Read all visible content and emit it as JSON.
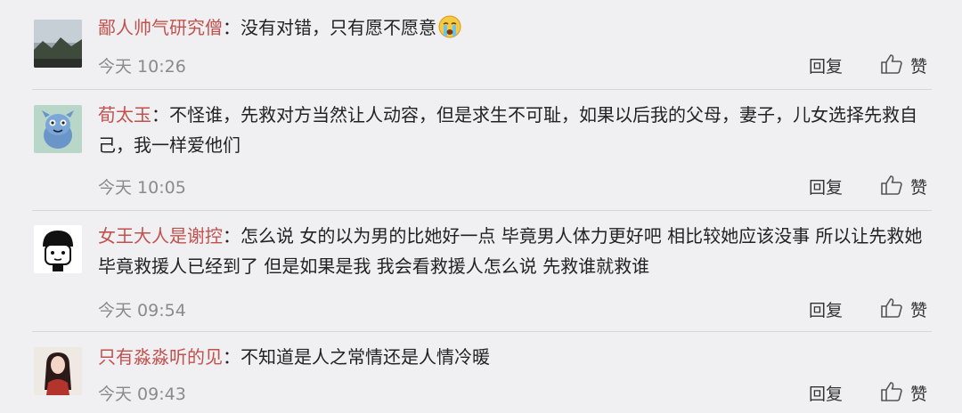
{
  "comments": [
    {
      "username": "鄙人帅气研究僧",
      "separator": "：",
      "text": "没有对错，只有愿不愿意",
      "emoji": "crying-face-emoji",
      "time": "今天 10:26",
      "reply_label": "回复",
      "like_label": "赞"
    },
    {
      "username": "荀太玉",
      "separator": "：",
      "text": "不怪谁，先救对方当然让人动容，但是求生不可耻，如果以后我的父母，妻子，儿女选择先救自己，我一样爱他们",
      "time": "今天 10:05",
      "reply_label": "回复",
      "like_label": "赞"
    },
    {
      "username": "女王大人是谢控",
      "separator": "：",
      "text": "怎么说 女的以为男的比她好一点 毕竟男人体力更好吧 相比较她应该没事 所以让先救她 毕竟救援人已经到了 但是如果是我 我会看救援人怎么说 先救谁就救谁",
      "time": "今天 09:54",
      "reply_label": "回复",
      "like_label": "赞"
    },
    {
      "username": "只有淼淼听的见",
      "separator": "：",
      "text": "不知道是人之常情还是人情冷暖",
      "time": "今天 09:43",
      "reply_label": "回复",
      "like_label": "赞"
    }
  ],
  "colors": {
    "background": "#f0f0f2",
    "username": "#c2514e",
    "text": "#222222",
    "meta": "#8a8a8a"
  }
}
